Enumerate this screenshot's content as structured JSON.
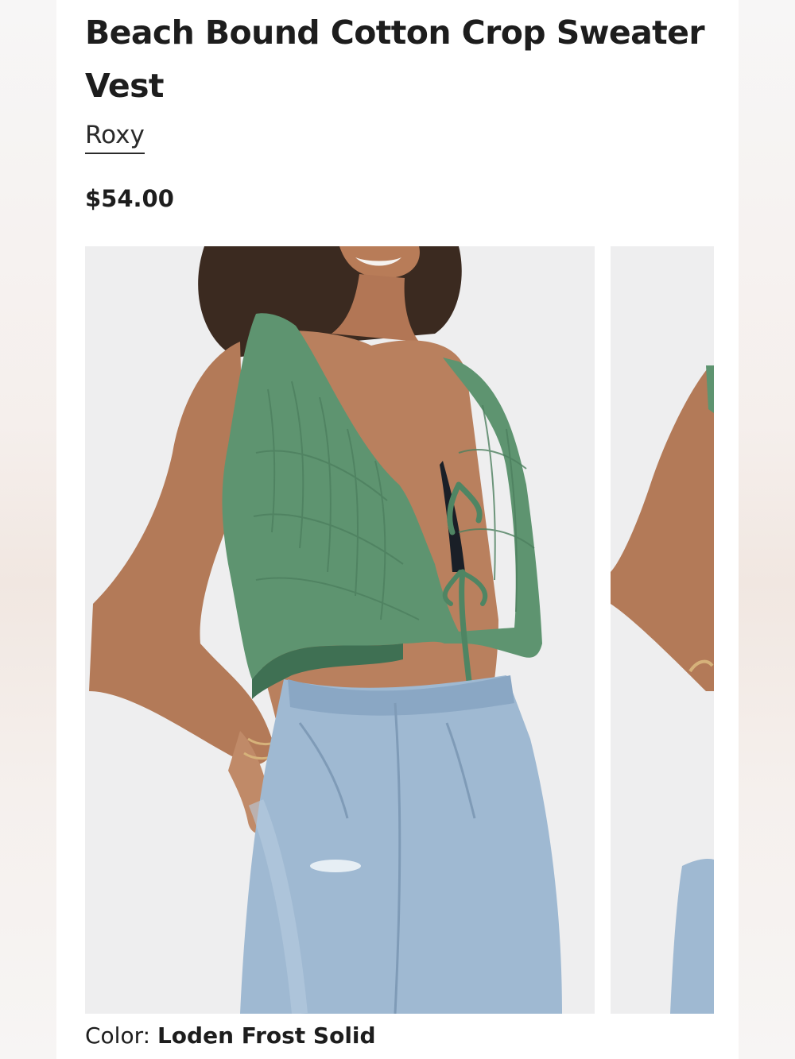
{
  "product": {
    "title": "Beach Bound Cotton Crop Sweater Vest",
    "brand": "Roxy",
    "price": "$54.00"
  },
  "gallery": {
    "images": [
      {
        "alt": "Model wearing green crochet crop sweater vest with front ties and light-wash jeans"
      },
      {
        "alt": "Partial view of next product photo"
      }
    ]
  },
  "color": {
    "label": "Color:",
    "value": "Loden Frost Solid"
  },
  "colors": {
    "vest": "#5e9470",
    "denim": "#9fb9d2",
    "skin": "#b9805e",
    "background": "#eeeeef"
  }
}
